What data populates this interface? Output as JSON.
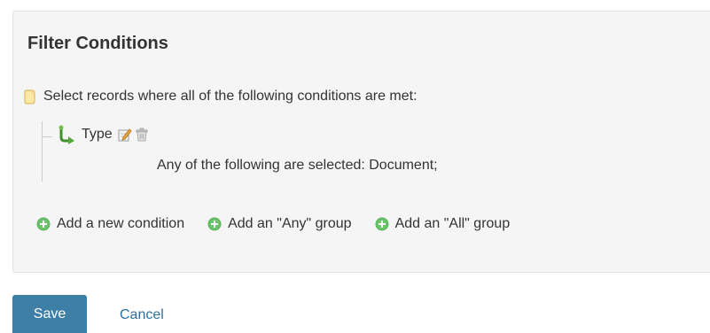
{
  "panel": {
    "title": "Filter Conditions",
    "root_text": "Select records where all of the following conditions are met:",
    "condition": {
      "field": "Type",
      "description": "Any of the following are selected: Document;"
    },
    "actions": [
      {
        "label": "Add a new condition",
        "icon": "plus-circle-icon"
      },
      {
        "label": "Add an \"Any\" group",
        "icon": "plus-circle-icon"
      },
      {
        "label": "Add an \"All\" group",
        "icon": "plus-circle-icon"
      }
    ]
  },
  "footer": {
    "save_label": "Save",
    "cancel_label": "Cancel"
  },
  "colors": {
    "panel_bg": "#f5f5f5",
    "save_bg": "#3e7fa8",
    "link": "#2f6f9e",
    "plus_green": "#5cb85c"
  }
}
